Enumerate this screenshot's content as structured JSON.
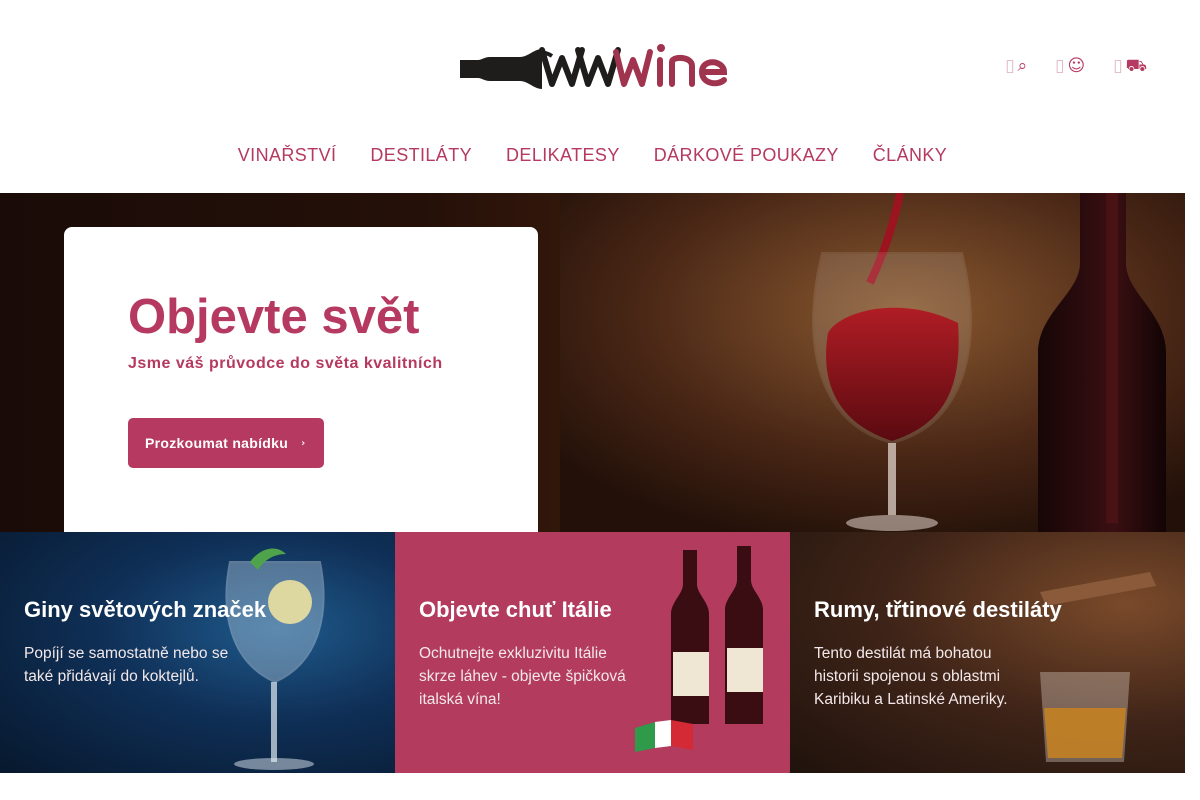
{
  "brand": {
    "logo_text": "wwwine",
    "accent": "#b53960",
    "dark": "#1f1c1c"
  },
  "header": {
    "icons": [
      {
        "name": "search-icon",
        "glyph": "⌕"
      },
      {
        "name": "user-icon",
        "glyph": "☺"
      },
      {
        "name": "cart-icon",
        "glyph": "⛟"
      }
    ]
  },
  "nav": {
    "items": [
      {
        "label": "VINAŘSTVÍ"
      },
      {
        "label": "DESTILÁTY"
      },
      {
        "label": "DELIKATESY"
      },
      {
        "label": "DÁRKOVÉ POUKAZY"
      },
      {
        "label": "ČLÁNKY"
      }
    ]
  },
  "hero": {
    "title": "Objevte svět",
    "subtitle": "Jsme váš průvodce do světa kvalitních",
    "button_label": "Prozkoumat nabídku",
    "button_icon": "›"
  },
  "banners": [
    {
      "title": "Giny světových značek",
      "text": "Popíjí se samostatně nebo se\ntaké přidávají do koktejlů."
    },
    {
      "title": "Objevte chuť Itálie",
      "text": "Ochutnejte exkluzivitu Itálie\nskrze láhev - objevte špičková\nitalská vína!"
    },
    {
      "title": "Rumy, třtinové destiláty",
      "text": "Tento destilát má bohatou\nhistorii spojenou s oblastmi\nKaribiku a Latinské Ameriky."
    }
  ]
}
